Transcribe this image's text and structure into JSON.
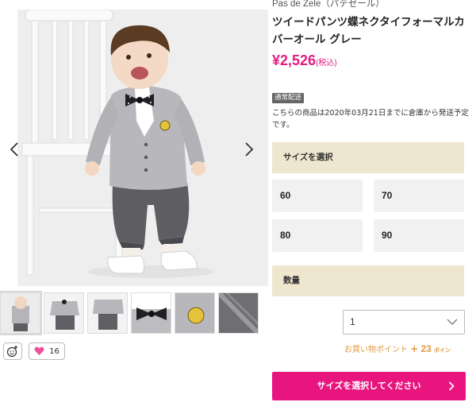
{
  "product": {
    "brand": "Pas de Zele（パデゼール）",
    "title": "ツイードパンツ蝶ネクタイフォーマルカバーオール グレー",
    "price": "¥2,526",
    "tax_note": "(税込)"
  },
  "shipping": {
    "badge": "通常配送",
    "note": "こちらの商品は2020年03月21日までに倉庫から発送予定です。"
  },
  "size": {
    "heading": "サイズを選択",
    "options": [
      "60",
      "70",
      "80",
      "90"
    ]
  },
  "quantity": {
    "heading": "数量",
    "selected": "1"
  },
  "points": {
    "label": "お買い物ポイント",
    "plus": "+",
    "value": "23",
    "unit": "ポイン"
  },
  "cta": {
    "label": "サイズを選択してください"
  },
  "likes": {
    "count": "16"
  },
  "colors": {
    "accent": "#e8157f",
    "price": "#e21d82",
    "section_bg": "#efe6cf",
    "points": "#e39a3f"
  },
  "icons": [
    "chevron-left-icon",
    "chevron-right-icon",
    "smiley-plus-icon",
    "heart-icon",
    "chevron-down-icon"
  ]
}
